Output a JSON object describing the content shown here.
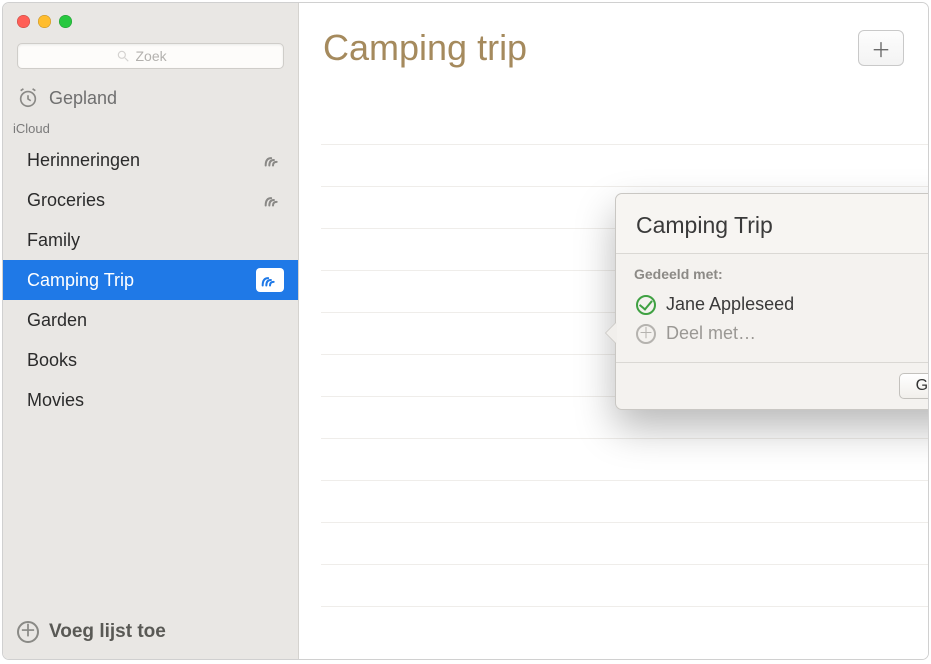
{
  "search": {
    "placeholder": "Zoek"
  },
  "sidebar": {
    "scheduled_label": "Gepland",
    "section_label": "iCloud",
    "items": [
      {
        "label": "Herinneringen",
        "shared": true,
        "selected": false
      },
      {
        "label": "Groceries",
        "shared": true,
        "selected": false
      },
      {
        "label": "Family",
        "shared": false,
        "selected": false
      },
      {
        "label": "Camping Trip",
        "shared": true,
        "selected": true
      },
      {
        "label": "Garden",
        "shared": false,
        "selected": false
      },
      {
        "label": "Books",
        "shared": false,
        "selected": false
      },
      {
        "label": "Movies",
        "shared": false,
        "selected": false
      }
    ],
    "add_list_label": "Voeg lijst toe"
  },
  "main": {
    "title": "Camping trip"
  },
  "popover": {
    "title": "Camping Trip",
    "shared_with_label": "Gedeeld met:",
    "participants": [
      {
        "name": "Jane Appleseed"
      }
    ],
    "add_participant_label": "Deel met…",
    "done_label": "Gereed"
  }
}
